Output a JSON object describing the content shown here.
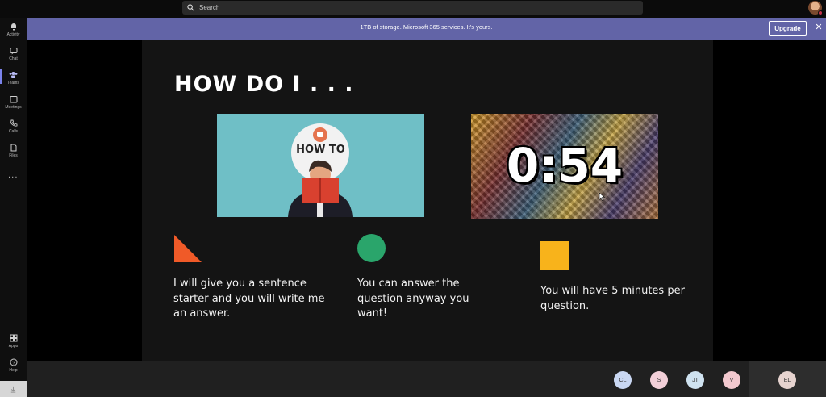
{
  "search": {
    "placeholder": "Search"
  },
  "rail": {
    "items": [
      {
        "label": "Activity",
        "icon": "bell-icon"
      },
      {
        "label": "Chat",
        "icon": "chat-icon"
      },
      {
        "label": "Teams",
        "icon": "teams-icon"
      },
      {
        "label": "Meetings",
        "icon": "calendar-icon"
      },
      {
        "label": "Calls",
        "icon": "phone-icon"
      },
      {
        "label": "Files",
        "icon": "file-icon"
      },
      {
        "label": "Apps",
        "icon": "apps-icon"
      },
      {
        "label": "Help",
        "icon": "help-icon"
      }
    ],
    "more": "..."
  },
  "banner": {
    "text": "1TB of storage. Microsoft 365 services. It's yours.",
    "upgrade": "Upgrade",
    "close": "✕"
  },
  "slide": {
    "title": "HOW DO I . . .",
    "howto_label": "HOW TO",
    "timer": "0:54",
    "col1": "I will give you a sentence starter and you will write me an answer.",
    "col2": "You can answer the question anyway you want!",
    "col3": "You will have 5 minutes per question."
  },
  "participants": [
    {
      "initials": "CL",
      "color": "#c9d7f2"
    },
    {
      "initials": "S",
      "color": "#f2cfd8"
    },
    {
      "initials": "JT",
      "color": "#cfe2f0"
    },
    {
      "initials": "V",
      "color": "#f3c9cf"
    }
  ],
  "self": {
    "initials": "EL",
    "color": "#e6d3cf"
  },
  "colors": {
    "banner": "#6264a7",
    "triangle": "#f05a28",
    "circle": "#2aa56b",
    "square": "#f8b31b"
  }
}
